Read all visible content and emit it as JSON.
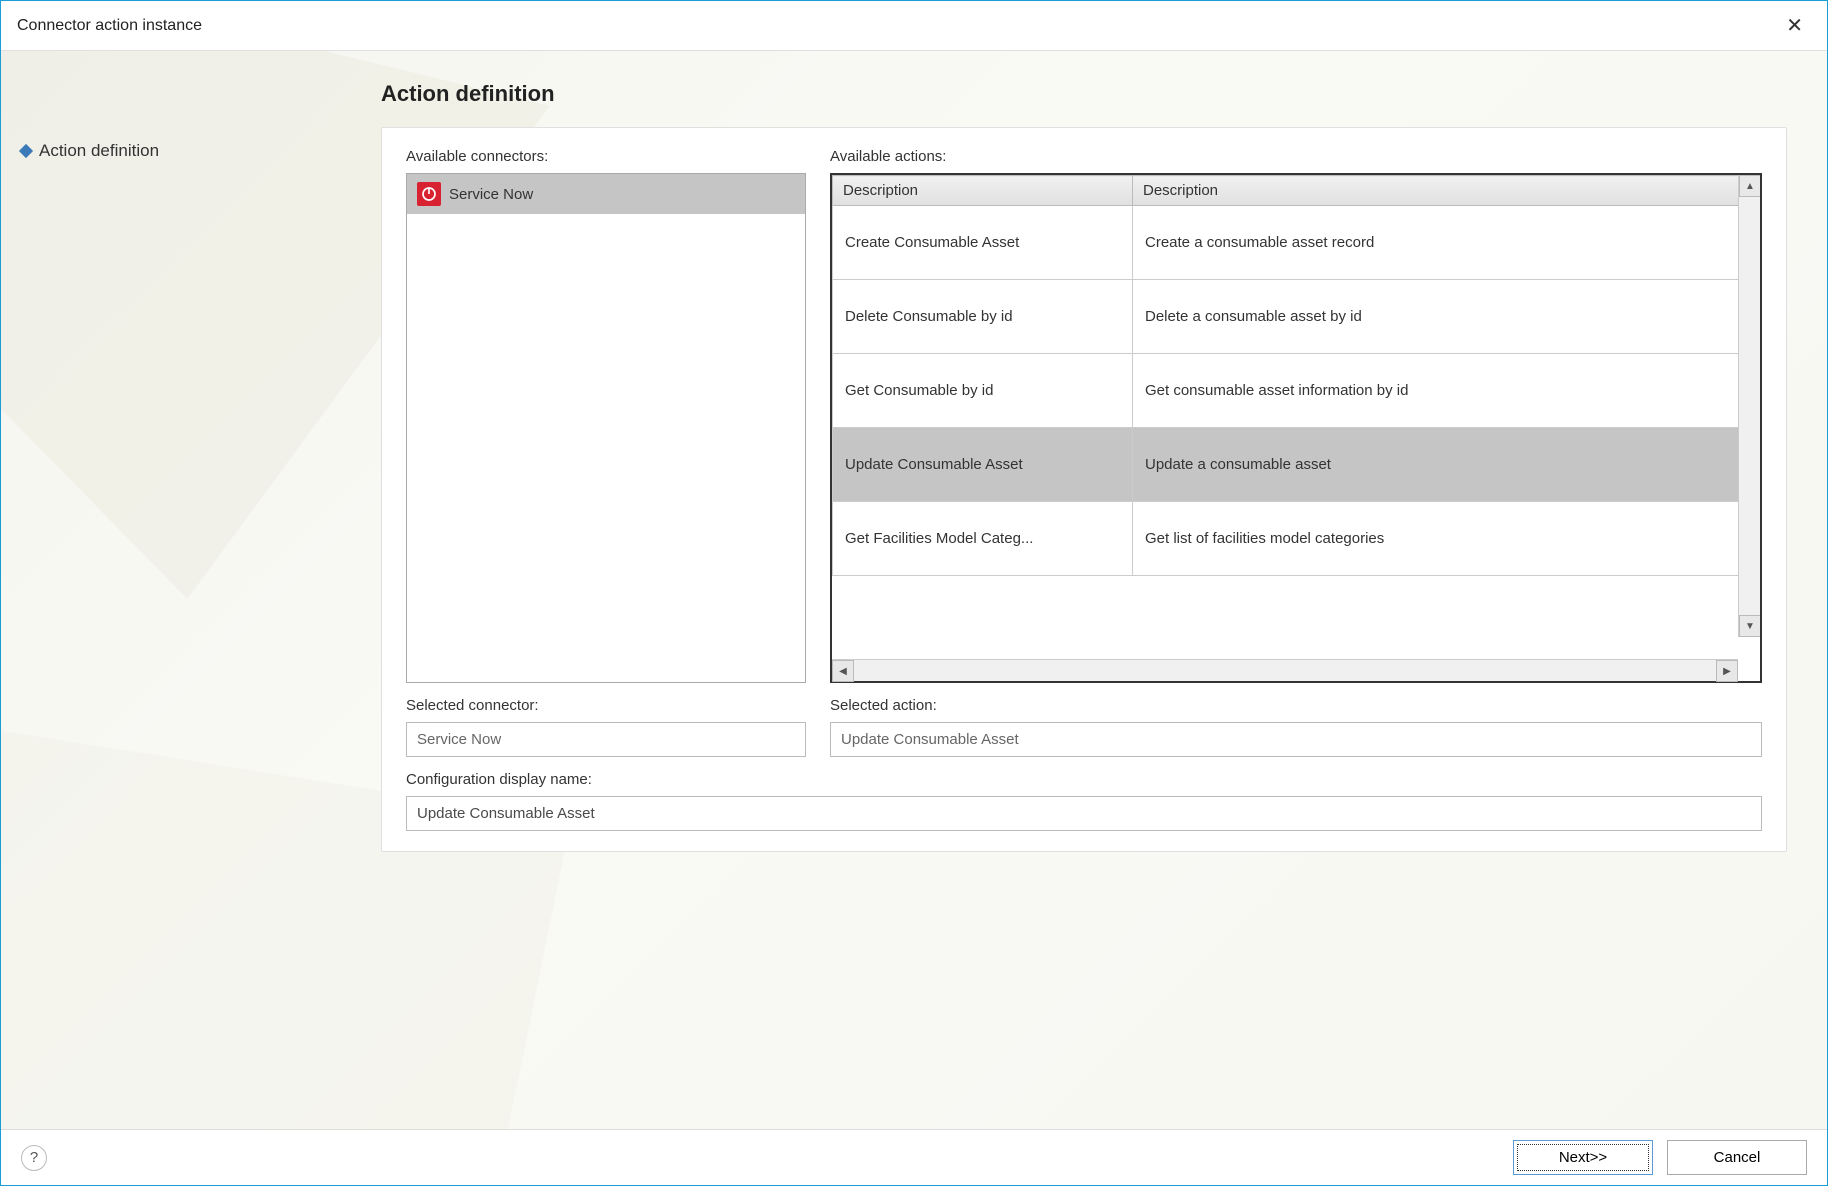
{
  "titlebar": {
    "title": "Connector action instance"
  },
  "sidebar": {
    "items": [
      {
        "label": "Action definition"
      }
    ]
  },
  "main": {
    "heading": "Action definition",
    "available_connectors_label": "Available connectors:",
    "available_actions_label": "Available actions:",
    "connectors": [
      {
        "name": "Service Now"
      }
    ],
    "actions_headers": {
      "col1": "Description",
      "col2": "Description"
    },
    "actions": [
      {
        "name": "Create Consumable Asset",
        "desc": "Create a consumable asset record",
        "selected": false
      },
      {
        "name": "Delete Consumable by id",
        "desc": "Delete a consumable asset by id",
        "selected": false
      },
      {
        "name": "Get Consumable by id",
        "desc": "Get consumable asset information by id",
        "selected": false
      },
      {
        "name": "Update Consumable Asset",
        "desc": "Update a consumable asset",
        "selected": true
      },
      {
        "name": "Get Facilities Model Categ...",
        "desc": "Get list of facilities model categories",
        "selected": false
      }
    ],
    "selected_connector_label": "Selected connector:",
    "selected_connector_value": "Service Now",
    "selected_action_label": "Selected action:",
    "selected_action_value": "Update Consumable Asset",
    "config_display_label": "Configuration display name:",
    "config_display_value": "Update Consumable Asset"
  },
  "footer": {
    "next_label": "Next>>",
    "cancel_label": "Cancel"
  }
}
